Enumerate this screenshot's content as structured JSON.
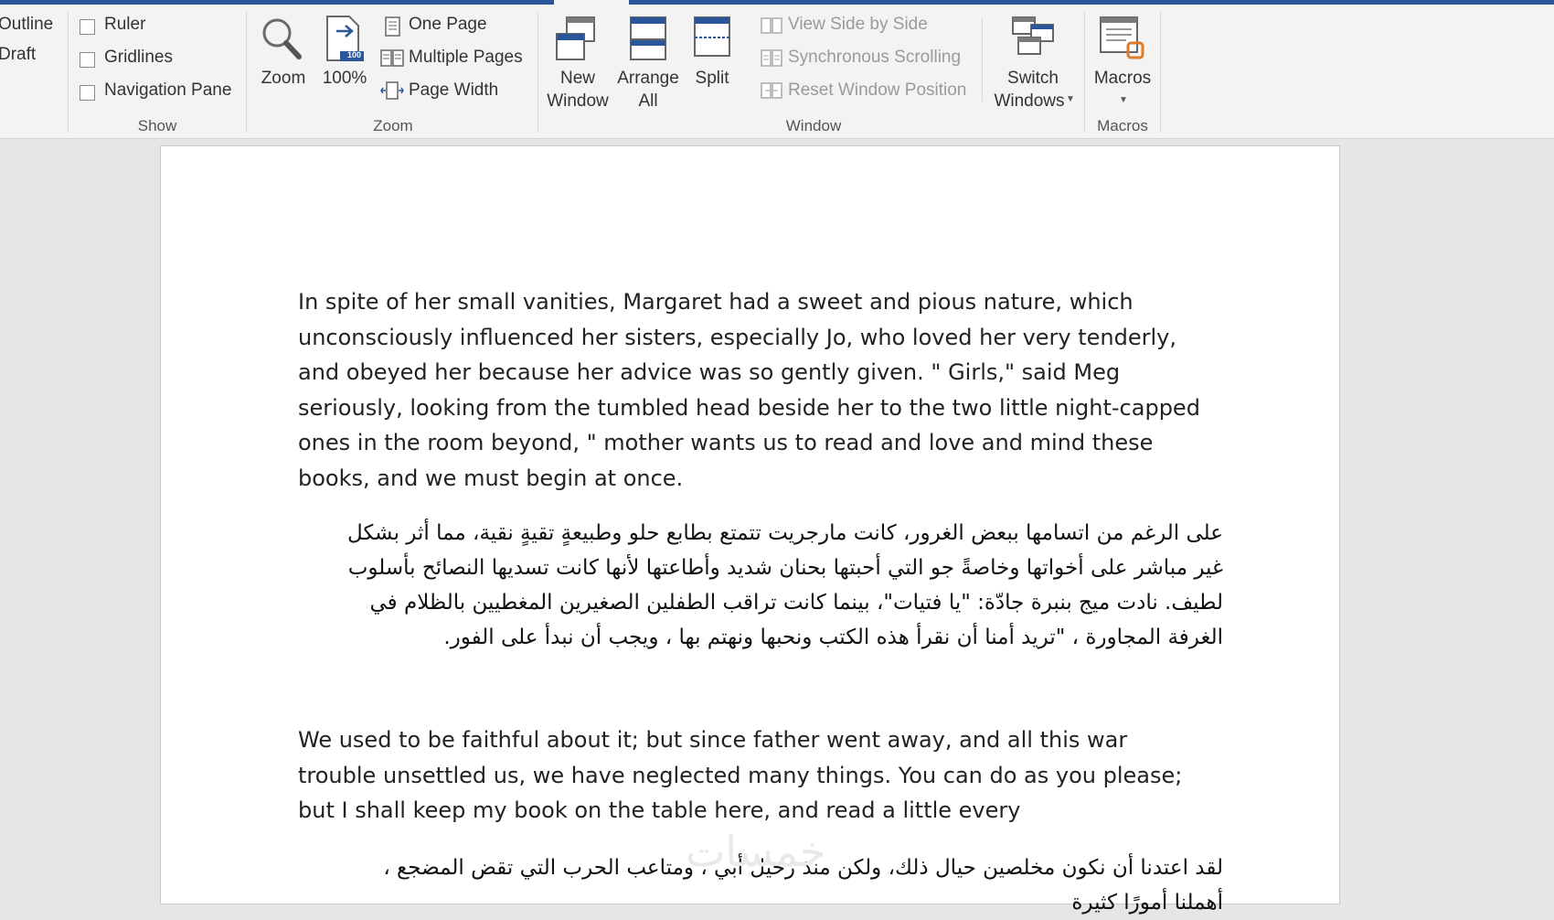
{
  "ribbon": {
    "views": {
      "outline": "Outline",
      "draft": "Draft"
    },
    "show": {
      "ruler": "Ruler",
      "gridlines": "Gridlines",
      "navigation_pane": "Navigation Pane",
      "label": "Show"
    },
    "zoom": {
      "zoom": "Zoom",
      "hundred": "100%",
      "hundred_badge": "100",
      "one_page": "One Page",
      "multiple_pages": "Multiple Pages",
      "page_width": "Page Width",
      "label": "Zoom"
    },
    "window": {
      "new_window_1": "New",
      "new_window_2": "Window",
      "arrange_all_1": "Arrange",
      "arrange_all_2": "All",
      "split": "Split",
      "view_side_by_side": "View Side by Side",
      "synchronous_scrolling": "Synchronous Scrolling",
      "reset_window_position": "Reset Window Position",
      "switch_windows_1": "Switch",
      "switch_windows_2": "Windows",
      "label": "Window"
    },
    "macros": {
      "macros": "Macros",
      "label": "Macros"
    }
  },
  "document": {
    "para1_en": "In spite of her small vanities, Margaret had a sweet and pious nature, which unconsciously influenced her sisters, especially Jo, who loved her very tenderly, and obeyed her because her advice was so gently given. \" Girls,\" said Meg seriously, looking from the tumbled head beside her to the two little night-capped ones in the room beyond, \" mother wants us to read and love and mind these books, and we must begin at once.",
    "para1_ar": "على الرغم من اتسامها ببعض الغرور، كانت مارجريت تتمتع بطابع حلو وطبيعةٍ تقيةٍ نقية، مما أثر بشكل غير مباشر على أخواتها وخاصةً جو التي أحبتها بحنان شديد وأطاعتها لأنها كانت تسديها النصائح بأسلوب لطيف. نادت ميج بنبرة جادّة: \"يا فتيات\"، بينما كانت تراقب الطفلين الصغيرين المغطيين بالظلام في الغرفة المجاورة ، \"تريد أمنا أن نقرأ هذه الكتب ونحبها ونهتم بها ، ويجب أن نبدأ على الفور.",
    "para2_en": "We used to be faithful about it; but since father went away, and all this war trouble unsettled us, we have neglected many things. You can do as you please; but I shall keep my book on the table here, and read a little every",
    "para2_ar": "لقد اعتدنا أن نكون مخلصين حيال ذلك، ولكن منذ رحيل أبي ، ومتاعب الحرب التي تقض المضجع ، أهملنا أمورًا كثيرة",
    "watermark": "خمسات"
  }
}
